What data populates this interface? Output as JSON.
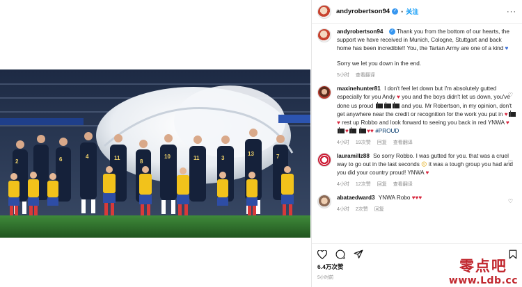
{
  "header": {
    "username": "andyrobertson94",
    "follow_label": "关注",
    "more_label": "···"
  },
  "caption": {
    "username": "andyrobertson94",
    "text": "Thank you from the bottom of our hearts, the support we have received in Munich, Cologne, Stuttgart and back home has been incredible!! You, the Tartan Army are one of a kind",
    "text2": "Sorry we let you down in the end.",
    "time": "5小时",
    "translate": "查看翻译"
  },
  "comments": [
    {
      "username": "maxinehunter81",
      "text_a": "I don't feel let down but I'm absolutely gutted especially for you Andy",
      "text_b": "you and the boys didn't let us down, you've done us proud",
      "text_c": "and you. Mr Robertson, in my opinion, don't get anywhere near the credit or recognition for the work you put in",
      "text_d": "rest up Robbo and look forward to seeing you back in red YNWA",
      "text_e": "#PROUD",
      "time": "4小时",
      "likes": "19次赞",
      "reply": "回复",
      "translate": "查看翻译"
    },
    {
      "username": "lauramillz88",
      "text_a": "So sorry Robbo. I was gutted for you. that was a cruel way to go out in the last seconds",
      "text_b": "it was a tough group you had and you did your country proud! YNWA",
      "time": "4小时",
      "likes": "12次赞",
      "reply": "回复",
      "translate": "查看翻译"
    },
    {
      "username": "abataedward3",
      "text_a": "YNWA Robo",
      "time": "4小时",
      "likes": "2次赞",
      "reply": "回复"
    }
  ],
  "footer": {
    "likes": "6.4万次赞",
    "ago": "5小时前"
  },
  "watermark": {
    "cn": "零点吧",
    "url": "www.Ldb.cc"
  },
  "colors": {
    "link_blue": "#0095f6",
    "heart_red": "#d7263d",
    "watermark_red": "#c0262d"
  }
}
